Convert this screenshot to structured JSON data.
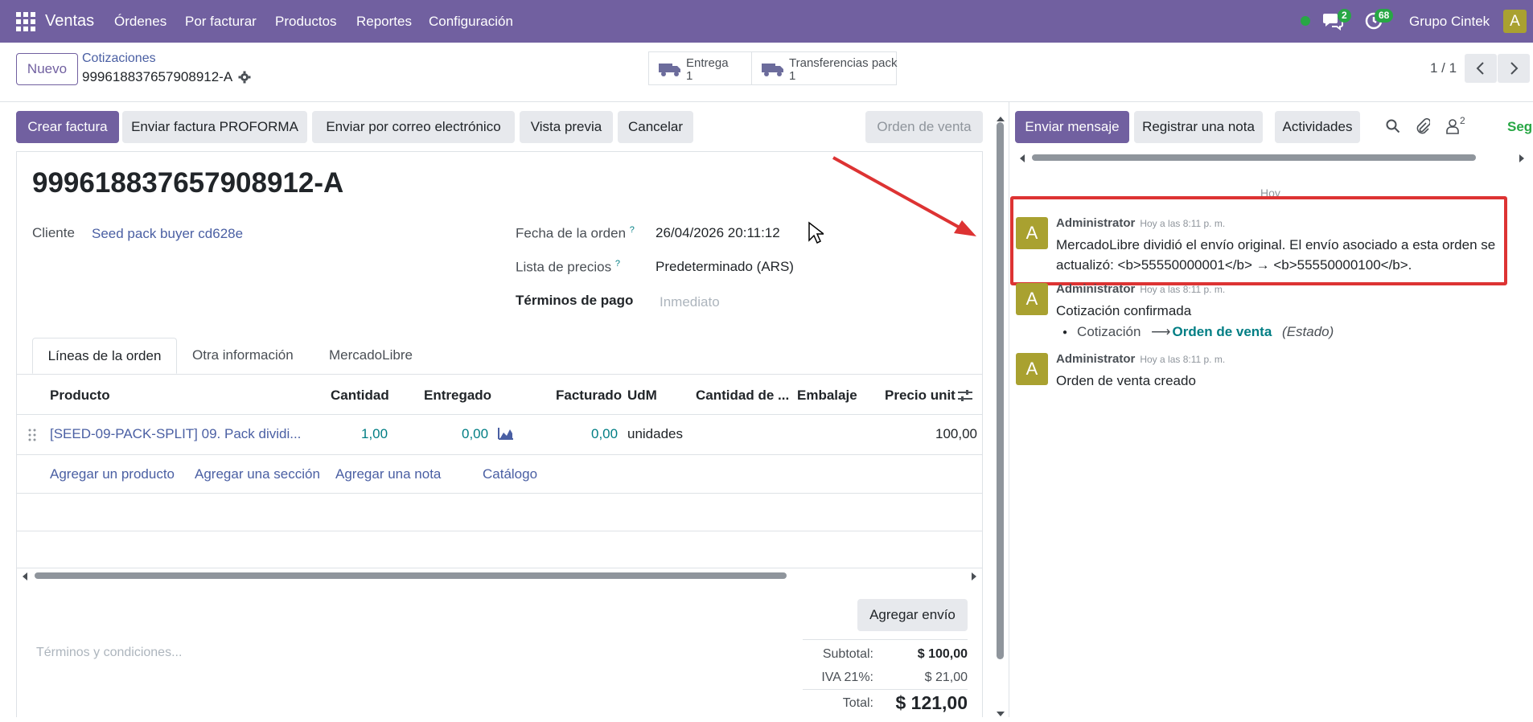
{
  "navbar": {
    "app_name": "Ventas",
    "menu": [
      "Órdenes",
      "Por facturar",
      "Productos",
      "Reportes",
      "Configuración"
    ],
    "chat_count": "2",
    "activity_count": "68",
    "company": "Grupo Cintek",
    "user_initial": "A"
  },
  "control": {
    "new_button": "Nuevo",
    "breadcrumb_parent": "Cotizaciones",
    "record_name": "999618837657908912-A",
    "smart_buttons": [
      {
        "label": "Entrega",
        "count": "1"
      },
      {
        "label": "Transferencias pack",
        "count": "1"
      }
    ],
    "pager": "1 / 1"
  },
  "actions": {
    "create_invoice": "Crear factura",
    "send_proforma": "Enviar factura PROFORMA",
    "send_email": "Enviar por correo electrónico",
    "preview": "Vista previa",
    "cancel": "Cancelar",
    "status": "Orden de venta"
  },
  "form": {
    "title": "999618837657908912-A",
    "customer_label": "Cliente",
    "customer_value": "Seed pack buyer cd628e",
    "order_date_label": "Fecha de la orden",
    "order_date_value": "26/04/2026 20:11:12",
    "pricelist_label": "Lista de precios",
    "pricelist_value": "Predeterminado (ARS)",
    "payment_terms_label": "Términos de pago",
    "payment_terms_placeholder": "Inmediato",
    "help_mark": "?"
  },
  "tabs": [
    "Líneas de la orden",
    "Otra información",
    "MercadoLibre"
  ],
  "order_lines": {
    "headers": [
      "Producto",
      "Cantidad",
      "Entregado",
      "Facturado",
      "UdM",
      "Cantidad de ...",
      "Embalaje",
      "Precio unit"
    ],
    "rows": [
      {
        "product": "[SEED-09-PACK-SPLIT] 09. Pack dividi...",
        "quantity": "1,00",
        "delivered": "0,00",
        "invoiced": "0,00",
        "uom": "unidades",
        "price_unit": "100,00"
      }
    ],
    "add_product": "Agregar un producto",
    "add_section": "Agregar una sección",
    "add_note": "Agregar una nota",
    "catalog": "Catálogo"
  },
  "footer": {
    "add_shipping": "Agregar envío",
    "terms_placeholder": "Términos y condiciones...",
    "subtotal_label": "Subtotal:",
    "subtotal_value": "$ 100,00",
    "tax_label": "IVA 21%:",
    "tax_value": "$ 21,00",
    "total_label": "Total:",
    "total_value": "$ 121,00"
  },
  "chatter": {
    "send_message": "Enviar mensaje",
    "log_note": "Registrar una nota",
    "activities": "Actividades",
    "follower_count": "2",
    "follow": "Seguir",
    "date_separator": "Hoy",
    "messages": [
      {
        "initial": "A",
        "author": "Administrator",
        "time": "Hoy a las 8:11 p. m.",
        "body": "MercadoLibre dividió el envío original. El envío asociado a esta orden se actualizó: <b>55550000001</b> → <b>55550000100</b>."
      },
      {
        "initial": "A",
        "author": "Administrator",
        "time": "Hoy a las 8:11 p. m.",
        "body": "Cotización confirmada",
        "tracking": {
          "old": "Cotización",
          "arrow": "⟶",
          "new": "Orden de venta",
          "field": "(Estado)"
        }
      },
      {
        "initial": "A",
        "author": "Administrator",
        "time": "Hoy a las 8:11 p. m.",
        "body": "Orden de venta creado"
      }
    ]
  },
  "colors": {
    "brand": "#7160a0",
    "link": "#017e84",
    "annotation": "#dd3333",
    "online": "#28a745"
  }
}
